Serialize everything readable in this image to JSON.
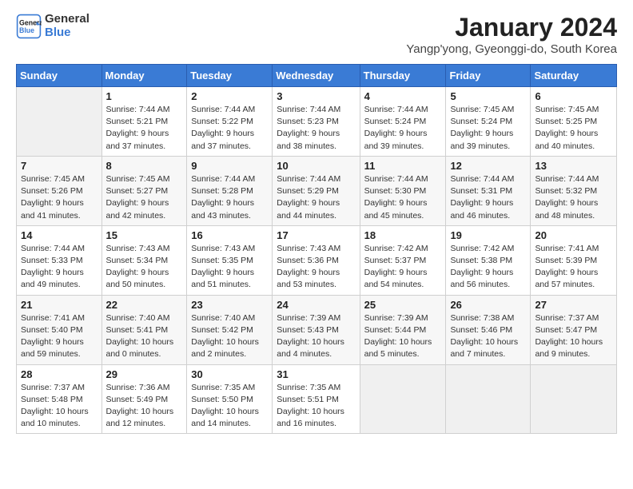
{
  "logo": {
    "line1": "General",
    "line2": "Blue"
  },
  "title": "January 2024",
  "location": "Yangp'yong, Gyeonggi-do, South Korea",
  "days_header": [
    "Sunday",
    "Monday",
    "Tuesday",
    "Wednesday",
    "Thursday",
    "Friday",
    "Saturday"
  ],
  "weeks": [
    [
      {
        "day": "",
        "info": ""
      },
      {
        "day": "1",
        "info": "Sunrise: 7:44 AM\nSunset: 5:21 PM\nDaylight: 9 hours\nand 37 minutes."
      },
      {
        "day": "2",
        "info": "Sunrise: 7:44 AM\nSunset: 5:22 PM\nDaylight: 9 hours\nand 37 minutes."
      },
      {
        "day": "3",
        "info": "Sunrise: 7:44 AM\nSunset: 5:23 PM\nDaylight: 9 hours\nand 38 minutes."
      },
      {
        "day": "4",
        "info": "Sunrise: 7:44 AM\nSunset: 5:24 PM\nDaylight: 9 hours\nand 39 minutes."
      },
      {
        "day": "5",
        "info": "Sunrise: 7:45 AM\nSunset: 5:24 PM\nDaylight: 9 hours\nand 39 minutes."
      },
      {
        "day": "6",
        "info": "Sunrise: 7:45 AM\nSunset: 5:25 PM\nDaylight: 9 hours\nand 40 minutes."
      }
    ],
    [
      {
        "day": "7",
        "info": "Sunrise: 7:45 AM\nSunset: 5:26 PM\nDaylight: 9 hours\nand 41 minutes."
      },
      {
        "day": "8",
        "info": "Sunrise: 7:45 AM\nSunset: 5:27 PM\nDaylight: 9 hours\nand 42 minutes."
      },
      {
        "day": "9",
        "info": "Sunrise: 7:44 AM\nSunset: 5:28 PM\nDaylight: 9 hours\nand 43 minutes."
      },
      {
        "day": "10",
        "info": "Sunrise: 7:44 AM\nSunset: 5:29 PM\nDaylight: 9 hours\nand 44 minutes."
      },
      {
        "day": "11",
        "info": "Sunrise: 7:44 AM\nSunset: 5:30 PM\nDaylight: 9 hours\nand 45 minutes."
      },
      {
        "day": "12",
        "info": "Sunrise: 7:44 AM\nSunset: 5:31 PM\nDaylight: 9 hours\nand 46 minutes."
      },
      {
        "day": "13",
        "info": "Sunrise: 7:44 AM\nSunset: 5:32 PM\nDaylight: 9 hours\nand 48 minutes."
      }
    ],
    [
      {
        "day": "14",
        "info": "Sunrise: 7:44 AM\nSunset: 5:33 PM\nDaylight: 9 hours\nand 49 minutes."
      },
      {
        "day": "15",
        "info": "Sunrise: 7:43 AM\nSunset: 5:34 PM\nDaylight: 9 hours\nand 50 minutes."
      },
      {
        "day": "16",
        "info": "Sunrise: 7:43 AM\nSunset: 5:35 PM\nDaylight: 9 hours\nand 51 minutes."
      },
      {
        "day": "17",
        "info": "Sunrise: 7:43 AM\nSunset: 5:36 PM\nDaylight: 9 hours\nand 53 minutes."
      },
      {
        "day": "18",
        "info": "Sunrise: 7:42 AM\nSunset: 5:37 PM\nDaylight: 9 hours\nand 54 minutes."
      },
      {
        "day": "19",
        "info": "Sunrise: 7:42 AM\nSunset: 5:38 PM\nDaylight: 9 hours\nand 56 minutes."
      },
      {
        "day": "20",
        "info": "Sunrise: 7:41 AM\nSunset: 5:39 PM\nDaylight: 9 hours\nand 57 minutes."
      }
    ],
    [
      {
        "day": "21",
        "info": "Sunrise: 7:41 AM\nSunset: 5:40 PM\nDaylight: 9 hours\nand 59 minutes."
      },
      {
        "day": "22",
        "info": "Sunrise: 7:40 AM\nSunset: 5:41 PM\nDaylight: 10 hours\nand 0 minutes."
      },
      {
        "day": "23",
        "info": "Sunrise: 7:40 AM\nSunset: 5:42 PM\nDaylight: 10 hours\nand 2 minutes."
      },
      {
        "day": "24",
        "info": "Sunrise: 7:39 AM\nSunset: 5:43 PM\nDaylight: 10 hours\nand 4 minutes."
      },
      {
        "day": "25",
        "info": "Sunrise: 7:39 AM\nSunset: 5:44 PM\nDaylight: 10 hours\nand 5 minutes."
      },
      {
        "day": "26",
        "info": "Sunrise: 7:38 AM\nSunset: 5:46 PM\nDaylight: 10 hours\nand 7 minutes."
      },
      {
        "day": "27",
        "info": "Sunrise: 7:37 AM\nSunset: 5:47 PM\nDaylight: 10 hours\nand 9 minutes."
      }
    ],
    [
      {
        "day": "28",
        "info": "Sunrise: 7:37 AM\nSunset: 5:48 PM\nDaylight: 10 hours\nand 10 minutes."
      },
      {
        "day": "29",
        "info": "Sunrise: 7:36 AM\nSunset: 5:49 PM\nDaylight: 10 hours\nand 12 minutes."
      },
      {
        "day": "30",
        "info": "Sunrise: 7:35 AM\nSunset: 5:50 PM\nDaylight: 10 hours\nand 14 minutes."
      },
      {
        "day": "31",
        "info": "Sunrise: 7:35 AM\nSunset: 5:51 PM\nDaylight: 10 hours\nand 16 minutes."
      },
      {
        "day": "",
        "info": ""
      },
      {
        "day": "",
        "info": ""
      },
      {
        "day": "",
        "info": ""
      }
    ]
  ]
}
